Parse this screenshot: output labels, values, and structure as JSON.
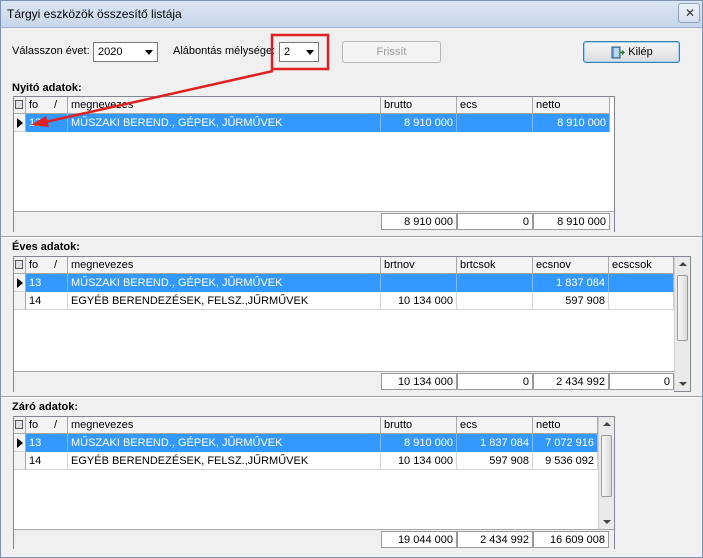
{
  "window": {
    "title": "Tárgyi eszközök összesítő listája",
    "close_glyph": "✕"
  },
  "toolbar": {
    "year_label": "Válasszon évet:",
    "year_value": "2020",
    "depth_label": "Alábontás mélysége:",
    "depth_value": "2",
    "refresh_label": "Frissít",
    "exit_label": "Kilép"
  },
  "opening": {
    "label": "Nyitó adatok:",
    "columns": [
      "fo",
      "megnevezes",
      "brutto",
      "ecs",
      "netto"
    ],
    "rows": [
      {
        "fo": "13",
        "megnevezes": "MŰSZAKI BEREND., GÉPEK, JŰRMŰVEK",
        "brutto": "8 910 000",
        "ecs": "",
        "netto": "8 910 000"
      }
    ],
    "totals": {
      "brutto": "8 910 000",
      "ecs": "0",
      "netto": "8 910 000"
    }
  },
  "annual": {
    "label": "Éves adatok:",
    "columns": [
      "fo",
      "megnevezes",
      "brtnov",
      "brtcsok",
      "ecsnov",
      "ecscsok"
    ],
    "rows": [
      {
        "fo": "13",
        "megnevezes": "MŰSZAKI BEREND., GÉPEK, JŰRMŰVEK",
        "brtnov": "",
        "brtcsok": "",
        "ecsnov": "1 837 084",
        "ecscsok": ""
      },
      {
        "fo": "14",
        "megnevezes": "EGYÉB BERENDEZÉSEK, FELSZ.,JŰRMŰVEK",
        "brtnov": "10 134 000",
        "brtcsok": "",
        "ecsnov": "597 908",
        "ecscsok": ""
      }
    ],
    "totals": {
      "brtnov": "10 134 000",
      "brtcsok": "0",
      "ecsnov": "2 434 992",
      "ecscsok": "0"
    }
  },
  "closing": {
    "label": "Záró adatok:",
    "columns": [
      "fo",
      "megnevezes",
      "brutto",
      "ecs",
      "netto"
    ],
    "rows": [
      {
        "fo": "13",
        "megnevezes": "MŰSZAKI BEREND., GÉPEK, JŰRMŰVEK",
        "brutto": "8 910 000",
        "ecs": "1 837 084",
        "netto": "7 072 916"
      },
      {
        "fo": "14",
        "megnevezes": "EGYÉB BERENDEZÉSEK, FELSZ.,JŰRMŰVEK",
        "brutto": "10 134 000",
        "ecs": "597 908",
        "netto": "9 536 092"
      }
    ],
    "totals": {
      "brutto": "19 044 000",
      "ecs": "2 434 992",
      "netto": "16 609 008"
    }
  },
  "colors": {
    "selection": "#3399ff",
    "annotation": "#e02020"
  }
}
